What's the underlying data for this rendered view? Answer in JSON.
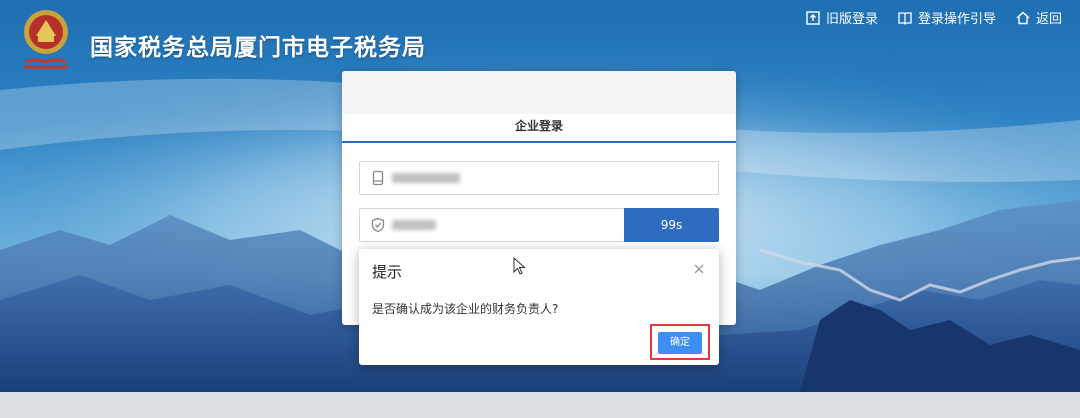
{
  "header": {
    "site_title": "国家税务总局厦门市电子税务局",
    "links": [
      {
        "label": "旧版登录",
        "icon": "export-icon"
      },
      {
        "label": "登录操作引导",
        "icon": "book-icon"
      },
      {
        "label": "返回",
        "icon": "home-icon"
      }
    ]
  },
  "login_card": {
    "tab_label": "企业登录",
    "countdown_label": "99s"
  },
  "dialog": {
    "title": "提示",
    "message": "是否确认成为该企业的财务负责人?",
    "confirm_label": "确定"
  },
  "colors": {
    "accent": "#2f6cc0",
    "confirm": "#3e8ef7",
    "highlight": "#e03b3b"
  }
}
